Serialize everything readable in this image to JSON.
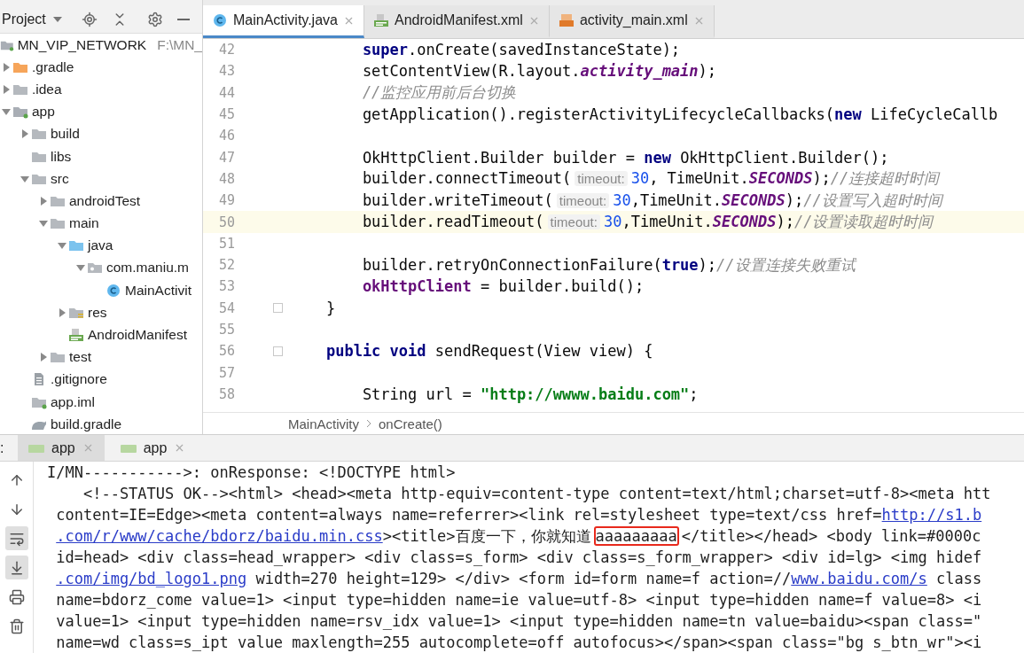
{
  "project_panel": {
    "title": "Project",
    "root": {
      "name": "MN_VIP_NETWORK",
      "path": "F:\\MN_",
      "kind": "module",
      "children": [
        {
          "name": ".gradle",
          "kind": "excluded_folder",
          "expanded": false
        },
        {
          "name": ".idea",
          "kind": "folder",
          "expanded": false
        },
        {
          "name": "app",
          "kind": "module",
          "expanded": true,
          "children": [
            {
              "name": "build",
              "kind": "folder",
              "expanded": false
            },
            {
              "name": "libs",
              "kind": "folder"
            },
            {
              "name": "src",
              "kind": "folder",
              "expanded": true,
              "children": [
                {
                  "name": "androidTest",
                  "kind": "folder",
                  "expanded": false
                },
                {
                  "name": "main",
                  "kind": "folder",
                  "expanded": true,
                  "children": [
                    {
                      "name": "java",
                      "kind": "source_folder",
                      "expanded": true,
                      "children": [
                        {
                          "name": "com.maniu.m",
                          "kind": "package",
                          "expanded": true,
                          "children": [
                            {
                              "name": "MainActivit",
                              "kind": "class"
                            }
                          ]
                        }
                      ]
                    },
                    {
                      "name": "res",
                      "kind": "resources",
                      "expanded": false
                    },
                    {
                      "name": "AndroidManifest",
                      "kind": "manifest"
                    }
                  ]
                },
                {
                  "name": "test",
                  "kind": "folder",
                  "expanded": false
                }
              ]
            },
            {
              "name": ".gitignore",
              "kind": "text_file"
            },
            {
              "name": "app.iml",
              "kind": "iml"
            },
            {
              "name": "build.gradle",
              "kind": "gradle"
            }
          ]
        }
      ]
    }
  },
  "editor": {
    "tabs": [
      {
        "label": "MainActivity.java",
        "kind": "class",
        "selected": true
      },
      {
        "label": "AndroidManifest.xml",
        "kind": "manifest",
        "selected": false
      },
      {
        "label": "activity_main.xml",
        "kind": "xml",
        "selected": false
      }
    ],
    "lines": [
      {
        "number": "42",
        "current": false,
        "fold": false,
        "segments": [
          {
            "kind": "keyword",
            "text": "        super"
          },
          {
            "kind": "plain",
            "text": ".onCreate(savedInstanceState);"
          }
        ]
      },
      {
        "number": "43",
        "current": false,
        "fold": false,
        "segments": [
          {
            "kind": "plain",
            "text": "        setContentView(R.layout."
          },
          {
            "kind": "field",
            "text": "activity_main"
          },
          {
            "kind": "plain",
            "text": ");"
          }
        ]
      },
      {
        "number": "44",
        "current": false,
        "fold": false,
        "segments": [
          {
            "kind": "comment",
            "text": "        //监控应用前后台切换"
          }
        ]
      },
      {
        "number": "45",
        "current": false,
        "fold": false,
        "segments": [
          {
            "kind": "plain",
            "text": "        getApplication().registerActivityLifecycleCallbacks("
          },
          {
            "kind": "keyword",
            "text": "new"
          },
          {
            "kind": "plain",
            "text": " LifeCycleCallb"
          }
        ]
      },
      {
        "number": "46",
        "current": false,
        "fold": false
      },
      {
        "number": "47",
        "current": false,
        "fold": false,
        "segments": [
          {
            "kind": "plain",
            "text": "        OkHttpClient.Builder builder = "
          },
          {
            "kind": "keyword",
            "text": "new"
          },
          {
            "kind": "plain",
            "text": " OkHttpClient.Builder();"
          }
        ]
      },
      {
        "number": "48",
        "current": false,
        "fold": false,
        "segments": [
          {
            "kind": "plain",
            "text": "        builder.connectTimeout("
          },
          {
            "kind": "hint",
            "text": "timeout:"
          },
          {
            "kind": "number",
            "text": "30"
          },
          {
            "kind": "plain",
            "text": ", TimeUnit."
          },
          {
            "kind": "field",
            "text": "SECONDS"
          },
          {
            "kind": "plain",
            "text": ");"
          },
          {
            "kind": "comment",
            "text": "//连接超时时间"
          }
        ]
      },
      {
        "number": "49",
        "current": false,
        "fold": false,
        "segments": [
          {
            "kind": "plain",
            "text": "        builder.writeTimeout("
          },
          {
            "kind": "hint",
            "text": "timeout:"
          },
          {
            "kind": "number",
            "text": "30"
          },
          {
            "kind": "plain",
            "text": ",TimeUnit."
          },
          {
            "kind": "field",
            "text": "SECONDS"
          },
          {
            "kind": "plain",
            "text": ");"
          },
          {
            "kind": "comment",
            "text": "//设置写入超时时间"
          }
        ]
      },
      {
        "number": "50",
        "current": true,
        "fold": false,
        "segments": [
          {
            "kind": "plain",
            "text": "        builder.readTimeout("
          },
          {
            "kind": "hint",
            "text": "timeout:"
          },
          {
            "kind": "number",
            "text": "30"
          },
          {
            "kind": "plain",
            "text": ",TimeUnit."
          },
          {
            "kind": "field",
            "text": "SECONDS"
          },
          {
            "kind": "plain",
            "text": ");"
          },
          {
            "kind": "comment",
            "text": "//设置读取超时时间"
          }
        ]
      },
      {
        "number": "51",
        "current": false,
        "fold": false
      },
      {
        "number": "52",
        "current": false,
        "fold": false,
        "segments": [
          {
            "kind": "plain",
            "text": "        builder.retryOnConnectionFailure("
          },
          {
            "kind": "keyword",
            "text": "true"
          },
          {
            "kind": "plain",
            "text": ");"
          },
          {
            "kind": "comment",
            "text": "//设置连接失败重试"
          }
        ]
      },
      {
        "number": "53",
        "current": false,
        "fold": false,
        "segments": [
          {
            "kind": "member",
            "text": "        okHttpClient"
          },
          {
            "kind": "plain",
            "text": " = builder.build();"
          }
        ]
      },
      {
        "number": "54",
        "current": false,
        "fold": true,
        "segments": [
          {
            "kind": "plain",
            "text": "    }"
          }
        ]
      },
      {
        "number": "55",
        "current": false,
        "fold": false
      },
      {
        "number": "56",
        "current": false,
        "fold": true,
        "segments": [
          {
            "kind": "keyword",
            "text": "    public void"
          },
          {
            "kind": "plain",
            "text": " sendRequest(View view) {"
          }
        ]
      },
      {
        "number": "57",
        "current": false,
        "fold": false
      },
      {
        "number": "58",
        "current": false,
        "fold": false,
        "segments": [
          {
            "kind": "plain",
            "text": "        String url = "
          },
          {
            "kind": "string",
            "text": "\"http://wwww.baidu.com\""
          },
          {
            "kind": "plain",
            "text": ";"
          }
        ]
      }
    ],
    "breadcrumbs": [
      "MainActivity",
      "onCreate()"
    ]
  },
  "run_panel": {
    "label": ":",
    "tabs": [
      {
        "label": "app",
        "selected": true
      },
      {
        "label": "app",
        "selected": false
      }
    ],
    "tools": [
      {
        "kind": "up",
        "toggled": false
      },
      {
        "kind": "down",
        "toggled": false
      },
      {
        "kind": "wrap",
        "toggled": true
      },
      {
        "kind": "scroll_end",
        "toggled": true
      },
      {
        "kind": "print",
        "toggled": false
      },
      {
        "kind": "delete",
        "toggled": false
      }
    ],
    "log_lines": [
      [
        {
          "kind": "text",
          "text": "I/MN----------->: onResponse: <!DOCTYPE html>"
        }
      ],
      [
        {
          "kind": "text",
          "text": "    <!--STATUS OK--><html> <head><meta http-equiv=content-type content=text/html;charset=utf-8><meta htt"
        }
      ],
      [
        {
          "kind": "text",
          "text": " content=IE=Edge><meta content=always name=referrer><link rel=stylesheet type=text/css href="
        },
        {
          "kind": "link",
          "text": "http://s1.b"
        }
      ],
      [
        {
          "kind": "link",
          "text": ".com/r/www/cache/bdorz/baidu.min.css"
        },
        {
          "kind": "text",
          "text": "><title>百度一下，你就知道"
        },
        {
          "kind": "highlighted",
          "text": "aaaaaaaaa"
        },
        {
          "kind": "text",
          "text": "</title></head> <body link=#0000c"
        }
      ],
      [
        {
          "kind": "text",
          "text": " id=head> <div class=head_wrapper> <div class=s_form> <div class=s_form_wrapper> <div id=lg> <img hidef"
        }
      ],
      [
        {
          "kind": "link",
          "text": ".com/img/bd_logo1.png"
        },
        {
          "kind": "text",
          "text": " width=270 height=129> </div> <form id=form name=f action=//"
        },
        {
          "kind": "link",
          "text": "www.baidu.com/s"
        },
        {
          "kind": "text",
          "text": " class"
        }
      ],
      [
        {
          "kind": "text",
          "text": " name=bdorz_come value=1> <input type=hidden name=ie value=utf-8> <input type=hidden name=f value=8> <i"
        }
      ],
      [
        {
          "kind": "text",
          "text": " value=1> <input type=hidden name=rsv_idx value=1> <input type=hidden name=tn value=baidu><span class=\""
        }
      ],
      [
        {
          "kind": "text",
          "text": " name=wd class=s_ipt value maxlength=255 autocomplete=off autofocus></span><span class=\"bg s_btn_wr\"><i"
        }
      ]
    ]
  }
}
